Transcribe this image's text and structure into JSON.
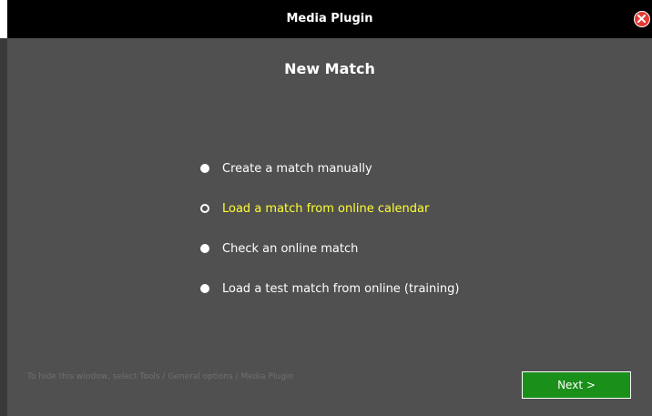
{
  "window": {
    "title": "Media Plugin",
    "close_icon": "close-icon"
  },
  "main": {
    "heading": "New Match",
    "options": [
      {
        "label": "Create a match manually",
        "selected": false,
        "highlighted": false
      },
      {
        "label": "Load a match from online calendar",
        "selected": true,
        "highlighted": true
      },
      {
        "label": "Check an online match",
        "selected": false,
        "highlighted": false
      },
      {
        "label": "Load a test match from online (training)",
        "selected": false,
        "highlighted": false
      }
    ]
  },
  "footer": {
    "note": "To hide this window, select Tools / General options / Media Plugin",
    "next_label": "Next >"
  },
  "colors": {
    "background": "#505050",
    "titlebar": "#000000",
    "highlight_text": "#ffff33",
    "next_button": "#1a8f1a",
    "close_button": "#e53935"
  }
}
